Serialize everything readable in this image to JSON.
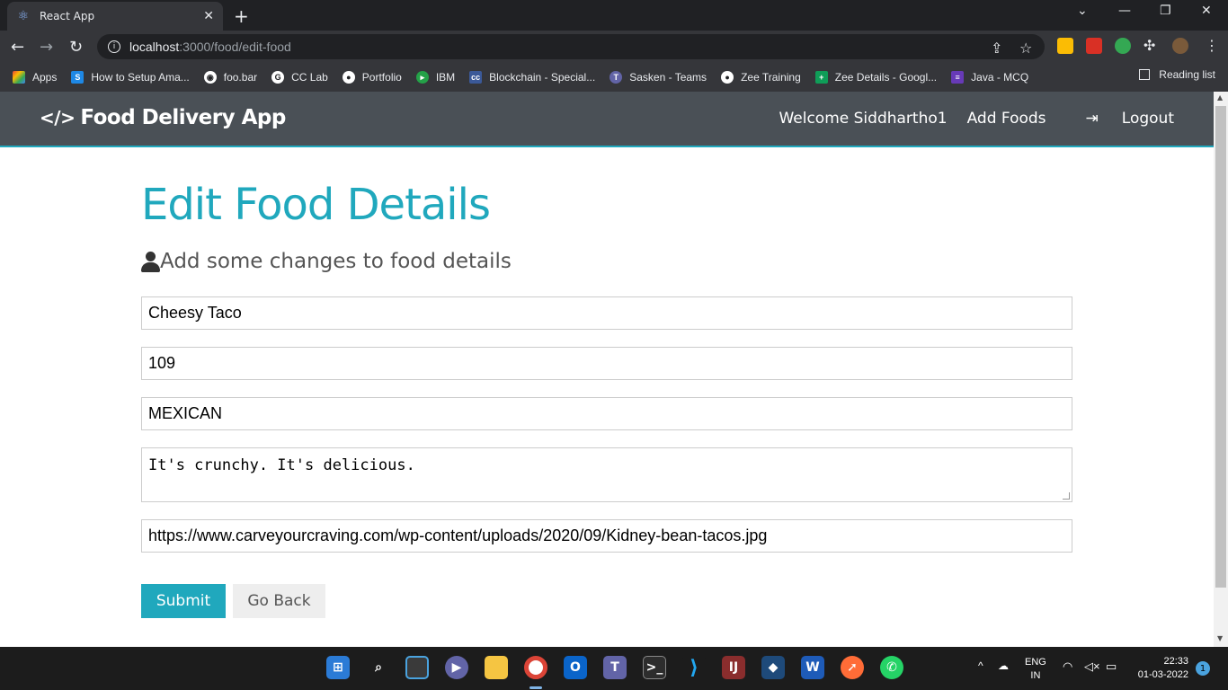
{
  "browser": {
    "tab_title": "React App",
    "url_host": "localhost",
    "url_rest": ":3000/food/edit-food",
    "bookmarks": [
      {
        "label": "Apps",
        "icon": "apps-grid-icon",
        "color": "#ea4335"
      },
      {
        "label": "How to Setup Ama...",
        "icon": "s-icon",
        "color": "#1e88e5"
      },
      {
        "label": "foo.bar",
        "icon": "globe-icon",
        "color": "#ffffff"
      },
      {
        "label": "CC Lab",
        "icon": "google-icon",
        "color": "#ffffff"
      },
      {
        "label": "Portfolio",
        "icon": "github-icon",
        "color": "#ffffff"
      },
      {
        "label": "IBM",
        "icon": "ibm-icon",
        "color": "#24a148"
      },
      {
        "label": "Blockchain - Special...",
        "icon": "cc-icon",
        "color": "#3b5998"
      },
      {
        "label": "Sasken - Teams",
        "icon": "teams-icon",
        "color": "#6264a7"
      },
      {
        "label": "Zee Training",
        "icon": "github-icon",
        "color": "#ffffff"
      },
      {
        "label": "Zee Details - Googl...",
        "icon": "sheets-icon",
        "color": "#0f9d58"
      },
      {
        "label": "Java - MCQ",
        "icon": "forms-icon",
        "color": "#673ab7"
      }
    ],
    "reading_list": "Reading list"
  },
  "app": {
    "brand": "Food Delivery App",
    "nav": {
      "welcome": "Welcome Siddhartho1",
      "add_foods": "Add Foods",
      "logout": "Logout"
    },
    "title": "Edit Food Details",
    "subtitle": "Add some changes to food details",
    "form": {
      "name": "Cheesy Taco",
      "price": "109",
      "category": "MEXICAN",
      "description": "It's crunchy. It's delicious.",
      "image_url": "https://www.carveyourcraving.com/wp-content/uploads/2020/09/Kidney-bean-tacos.jpg"
    },
    "buttons": {
      "submit": "Submit",
      "back": "Go Back"
    },
    "colors": {
      "accent": "#20a8bd",
      "navbar": "#4a5056"
    }
  },
  "taskbar": {
    "lang_top": "ENG",
    "lang_bottom": "IN",
    "time": "22:33",
    "date": "01-03-2022",
    "notifications": "1"
  }
}
